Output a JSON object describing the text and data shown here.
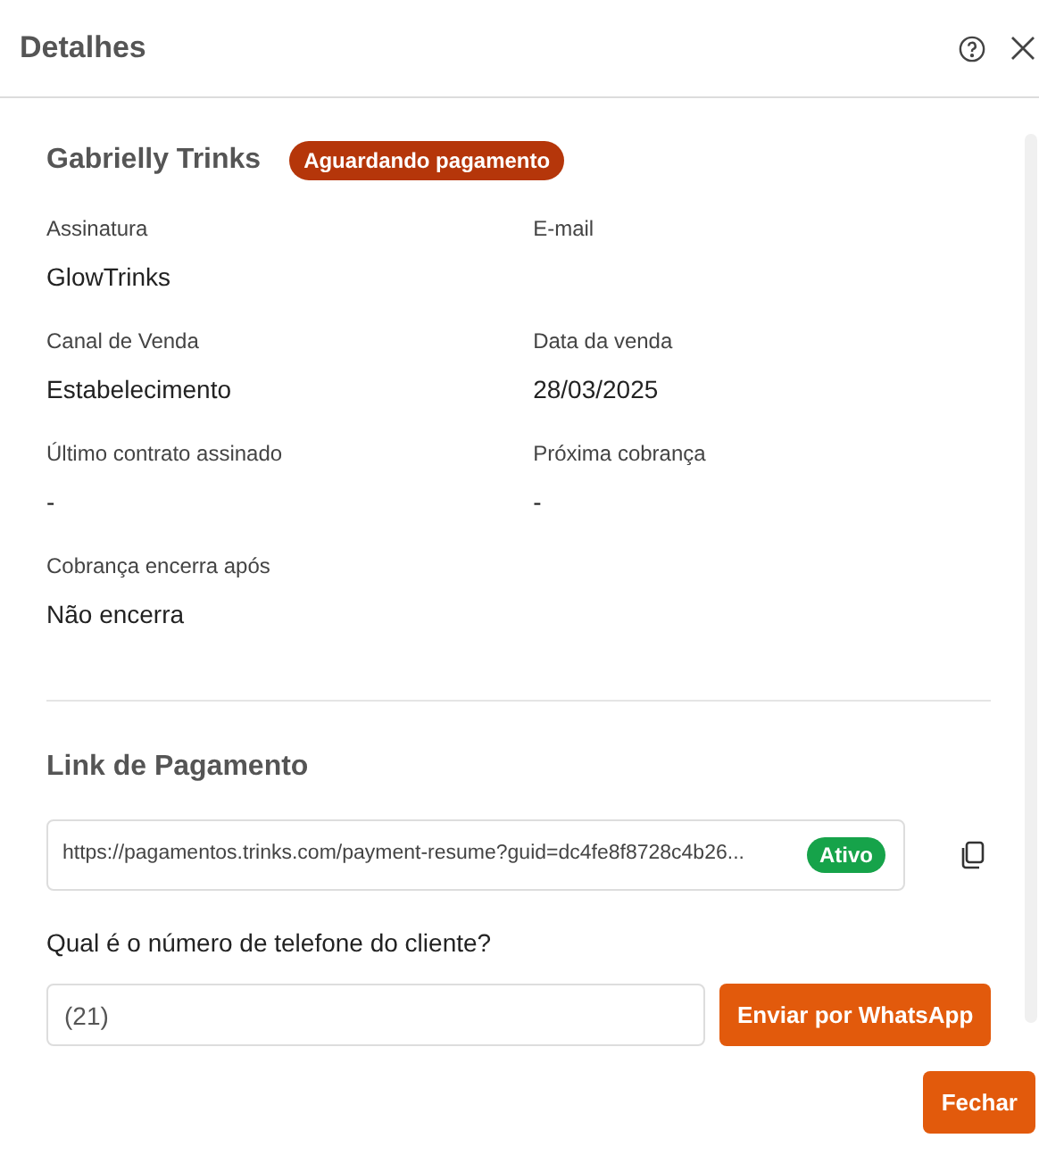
{
  "header": {
    "title": "Detalhes"
  },
  "client": {
    "name": "Gabrielly Trinks",
    "status": {
      "label": "Aguardando pagamento",
      "color": "#b5360a"
    }
  },
  "fields": [
    {
      "label": "Assinatura",
      "value": "GlowTrinks"
    },
    {
      "label": "E-mail"
    },
    {
      "label": "Canal de Venda",
      "value": "Estabelecimento"
    },
    {
      "label": "Data da venda",
      "value": "28/03/2025"
    },
    {
      "label": "Último contrato assinado",
      "value": "-"
    },
    {
      "label": "Próxima cobrança",
      "value": "-"
    },
    {
      "label": "Cobrança encerra após",
      "value": "Não encerra"
    }
  ],
  "payment_link": {
    "title": "Link de Pagamento",
    "url": "https://pagamentos.trinks.com/payment-resume?guid=dc4fe8f8728c4b26...",
    "status": {
      "label": "Ativo",
      "color": "#16a34a"
    }
  },
  "phone": {
    "question": "Qual é o número de telefone do cliente?",
    "value": "(21)",
    "button": "Enviar por WhatsApp"
  },
  "footer": {
    "button": "Fechar"
  }
}
